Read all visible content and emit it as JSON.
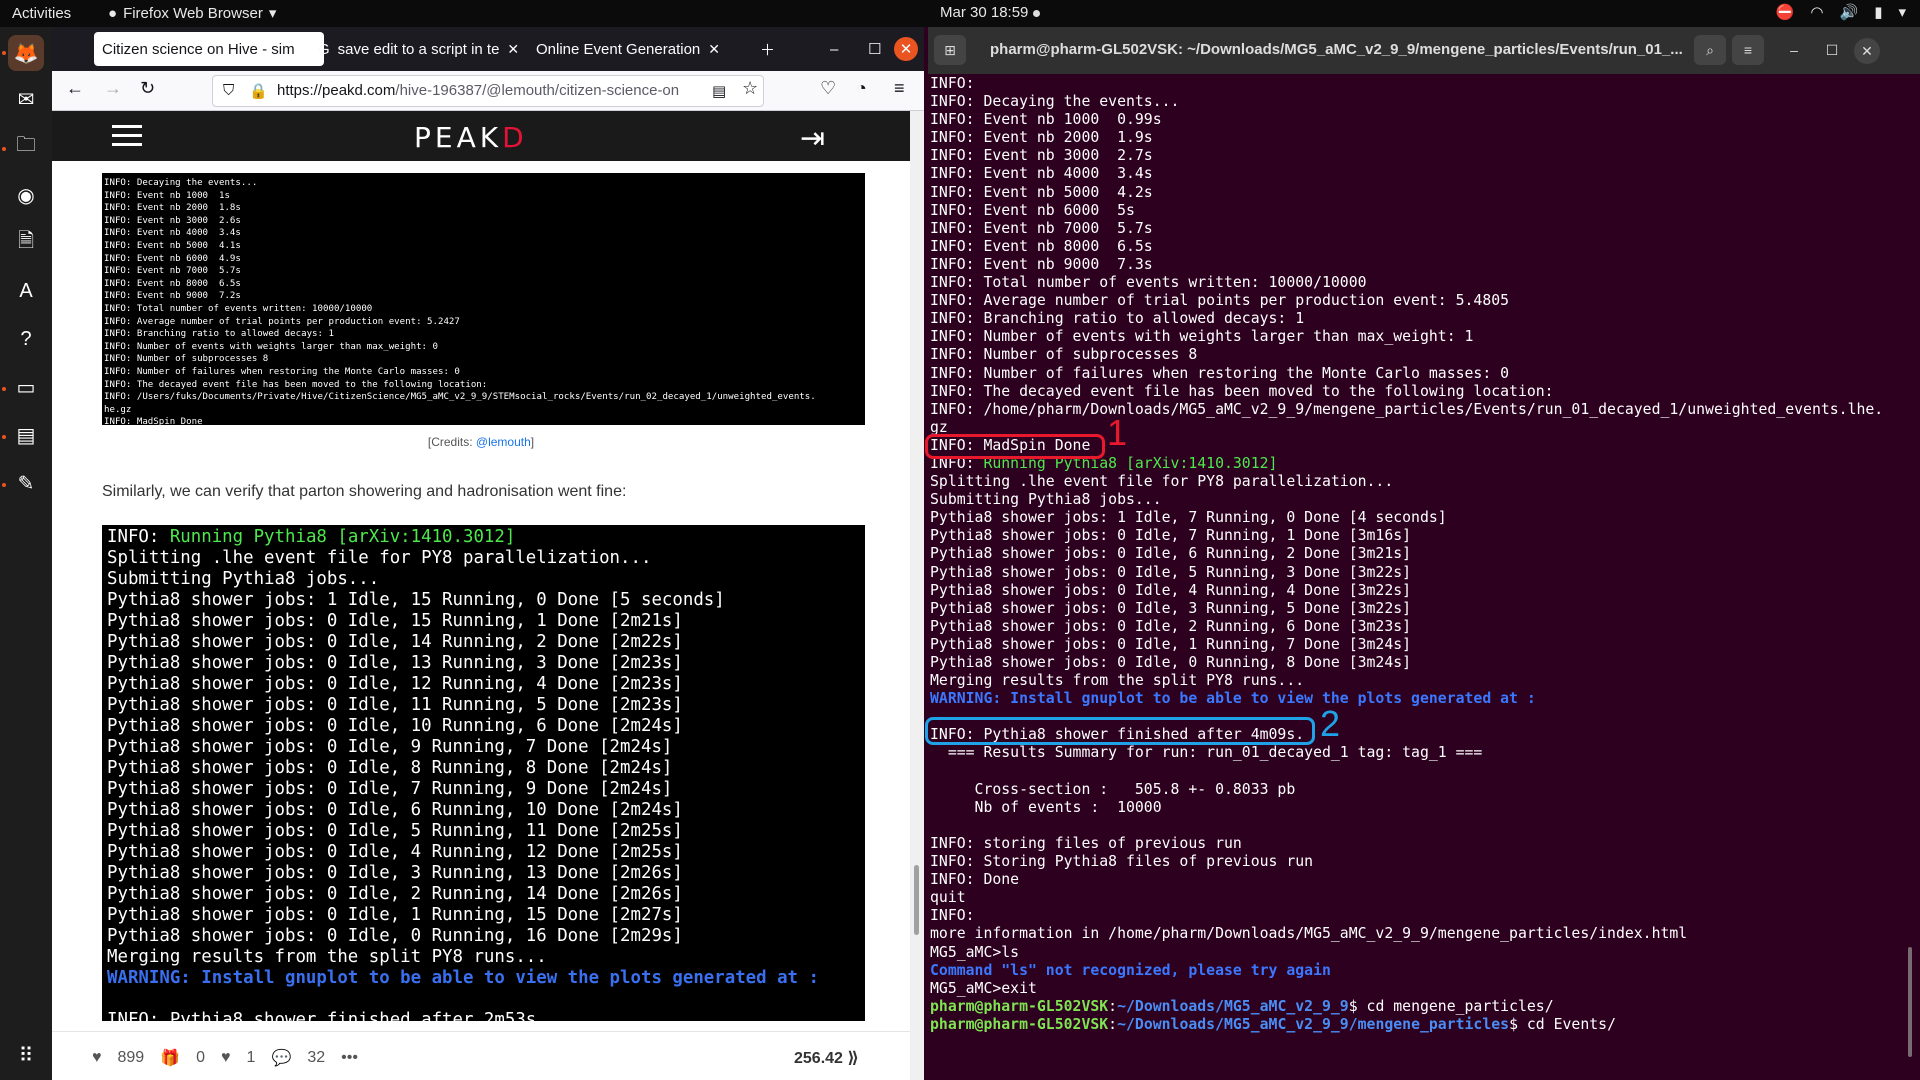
{
  "topbar": {
    "activities": "Activities",
    "app": "Firefox Web Browser",
    "clock": "Mar 30  18:59"
  },
  "firefox": {
    "tabs": [
      {
        "title": "Citizen science on Hive - sim"
      },
      {
        "title": "save edit to a script in te"
      },
      {
        "title": "Online Event Generation"
      }
    ],
    "url_host": "https://peakd.com",
    "url_path": "/hive-196387/@lemouth/citizen-science-on",
    "logo_main": "PEAK",
    "logo_accent": "D",
    "term1_lines": [
      "INFO: Decaying the events...",
      "INFO: Event nb 1000  1s",
      "INFO: Event nb 2000  1.8s",
      "INFO: Event nb 3000  2.6s",
      "INFO: Event nb 4000  3.4s",
      "INFO: Event nb 5000  4.1s",
      "INFO: Event nb 6000  4.9s",
      "INFO: Event nb 7000  5.7s",
      "INFO: Event nb 8000  6.5s",
      "INFO: Event nb 9000  7.2s",
      "INFO: Total number of events written: 10000/10000",
      "INFO: Average number of trial points per production event: 5.2427",
      "INFO: Branching ratio to allowed decays: 1",
      "INFO: Number of events with weights larger than max_weight: 0",
      "INFO: Number of subprocesses 8",
      "INFO: Number of failures when restoring the Monte Carlo masses: 0",
      "INFO: The decayed event file has been moved to the following location:",
      "INFO: /Users/fuks/Documents/Private/Hive/CitizenScience/MG5_aMC_v2_9_9/STEMsocial_rocks/Events/run_02_decayed_1/unweighted_events.",
      "he.gz",
      "INFO: MadSpin Done"
    ],
    "credit_prefix": "[Credits: ",
    "credit_user": "@lemouth",
    "credit_suffix": "]",
    "paragraph": "Similarly, we can verify that parton showering and hadronisation went fine:",
    "term2_first_info": "INFO: ",
    "term2_first_green": "Running Pythia8 [arXiv:1410.3012]",
    "term2_lines": [
      "Splitting .lhe event file for PY8 parallelization...",
      "Submitting Pythia8 jobs...",
      "Pythia8 shower jobs: 1 Idle, 15 Running, 0 Done [5 seconds]",
      "Pythia8 shower jobs: 0 Idle, 15 Running, 1 Done [2m21s]",
      "Pythia8 shower jobs: 0 Idle, 14 Running, 2 Done [2m22s]",
      "Pythia8 shower jobs: 0 Idle, 13 Running, 3 Done [2m23s]",
      "Pythia8 shower jobs: 0 Idle, 12 Running, 4 Done [2m23s]",
      "Pythia8 shower jobs: 0 Idle, 11 Running, 5 Done [2m23s]",
      "Pythia8 shower jobs: 0 Idle, 10 Running, 6 Done [2m24s]",
      "Pythia8 shower jobs: 0 Idle, 9 Running, 7 Done [2m24s]",
      "Pythia8 shower jobs: 0 Idle, 8 Running, 8 Done [2m24s]",
      "Pythia8 shower jobs: 0 Idle, 7 Running, 9 Done [2m24s]",
      "Pythia8 shower jobs: 0 Idle, 6 Running, 10 Done [2m24s]",
      "Pythia8 shower jobs: 0 Idle, 5 Running, 11 Done [2m25s]",
      "Pythia8 shower jobs: 0 Idle, 4 Running, 12 Done [2m25s]",
      "Pythia8 shower jobs: 0 Idle, 3 Running, 13 Done [2m26s]",
      "Pythia8 shower jobs: 0 Idle, 2 Running, 14 Done [2m26s]",
      "Pythia8 shower jobs: 0 Idle, 1 Running, 15 Done [2m27s]",
      "Pythia8 shower jobs: 0 Idle, 0 Running, 16 Done [2m29s]",
      "Merging results from the split PY8 runs..."
    ],
    "term2_warning": "WARNING: Install gnuplot to be able to view the plots generated at :",
    "term2_last": "INFO: Pythia8 shower finished after 2m53s",
    "footer": {
      "votes": "899",
      "reblogs": "0",
      "likes": "1",
      "comments": "32",
      "more": "•••",
      "payout": "256.42"
    }
  },
  "terminal": {
    "title": "pharm@pharm-GL502VSK: ~/Downloads/MG5_aMC_v2_9_9/mengene_particles/Events/run_01_...",
    "lines_a": [
      "INFO:",
      "INFO: Decaying the events...",
      "INFO: Event nb 1000  0.99s",
      "INFO: Event nb 2000  1.9s",
      "INFO: Event nb 3000  2.7s",
      "INFO: Event nb 4000  3.4s",
      "INFO: Event nb 5000  4.2s",
      "INFO: Event nb 6000  5s",
      "INFO: Event nb 7000  5.7s",
      "INFO: Event nb 8000  6.5s",
      "INFO: Event nb 9000  7.3s",
      "INFO: Total number of events written: 10000/10000",
      "INFO: Average number of trial points per production event: 5.4805",
      "INFO: Branching ratio to allowed decays: 1",
      "INFO: Number of events with weights larger than max_weight: 1",
      "INFO: Number of subprocesses 8",
      "INFO: Number of failures when restoring the Monte Carlo masses: 0",
      "INFO: The decayed event file has been moved to the following location:",
      "INFO: /home/pharm/Downloads/MG5_aMC_v2_9_9/mengene_particles/Events/run_01_decayed_1/unweighted_events.lhe.",
      "gz",
      "INFO: MadSpin Done"
    ],
    "running_info": "INFO: ",
    "running_green": "Running Pythia8 [arXiv:1410.3012]",
    "lines_b": [
      "Splitting .lhe event file for PY8 parallelization...",
      "Submitting Pythia8 jobs...",
      "Pythia8 shower jobs: 1 Idle, 7 Running, 0 Done [4 seconds]",
      "Pythia8 shower jobs: 0 Idle, 7 Running, 1 Done [3m16s]",
      "Pythia8 shower jobs: 0 Idle, 6 Running, 2 Done [3m21s]",
      "Pythia8 shower jobs: 0 Idle, 5 Running, 3 Done [3m22s]",
      "Pythia8 shower jobs: 0 Idle, 4 Running, 4 Done [3m22s]",
      "Pythia8 shower jobs: 0 Idle, 3 Running, 5 Done [3m22s]",
      "Pythia8 shower jobs: 0 Idle, 2 Running, 6 Done [3m23s]",
      "Pythia8 shower jobs: 0 Idle, 1 Running, 7 Done [3m24s]",
      "Pythia8 shower jobs: 0 Idle, 0 Running, 8 Done [3m24s]",
      "Merging results from the split PY8 runs..."
    ],
    "warning": "WARNING: Install gnuplot to be able to view the plots generated at :",
    "lines_c": [
      "",
      "INFO: Pythia8 shower finished after 4m09s.",
      "  === Results Summary for run: run_01_decayed_1 tag: tag_1 ===",
      "",
      "     Cross-section :   505.8 +- 0.8033 pb",
      "     Nb of events :  10000",
      "",
      "INFO: storing files of previous run",
      "INFO: Storing Pythia8 files of previous run",
      "INFO: Done",
      "quit",
      "INFO:",
      "more information in /home/pharm/Downloads/MG5_aMC_v2_9_9/mengene_particles/index.html",
      "MG5_aMC>ls"
    ],
    "not_recognized": "Command \"ls\" not recognized, please try again",
    "exit_line": "MG5_aMC>exit",
    "prompt1_user": "pharm@pharm-GL502VSK",
    "prompt1_path": "~/Downloads/MG5_aMC_v2_9_9",
    "prompt1_cmd": "$ cd mengene_particles/",
    "prompt2_user": "pharm@pharm-GL502VSK",
    "prompt2_path": "~/Downloads/MG5_aMC_v2_9_9/mengene_particles",
    "prompt2_cmd": "$ cd Events/"
  },
  "annotations": {
    "red_number": "1",
    "blue_number": "2"
  }
}
